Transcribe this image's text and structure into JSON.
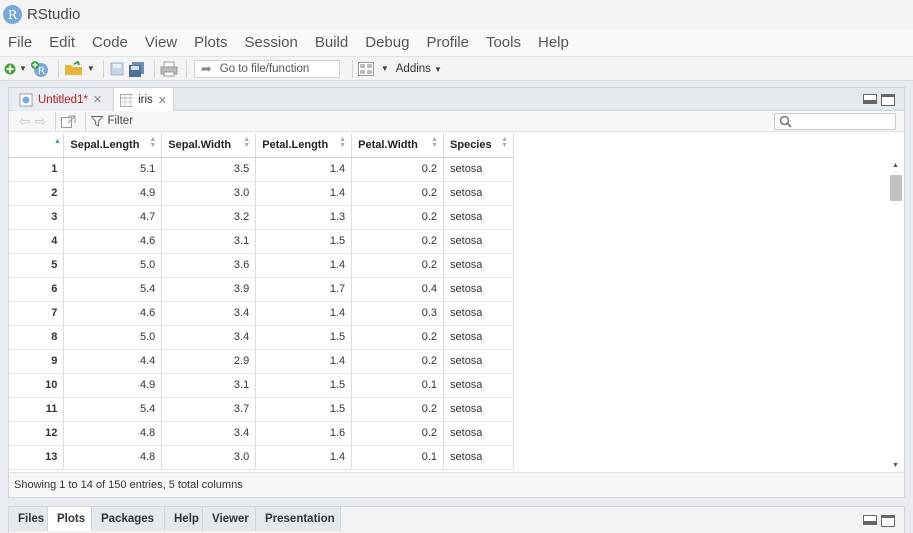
{
  "app": {
    "logo_letter": "R",
    "title": "RStudio"
  },
  "menu": [
    "File",
    "Edit",
    "Code",
    "View",
    "Plots",
    "Session",
    "Build",
    "Debug",
    "Profile",
    "Tools",
    "Help"
  ],
  "toolbar": {
    "goto_placeholder": "Go to file/function",
    "addins_label": "Addins"
  },
  "tabs": [
    {
      "label": "Untitled1*",
      "active": false
    },
    {
      "label": "iris",
      "active": true
    }
  ],
  "viewer": {
    "filter_label": "Filter",
    "search_value": ""
  },
  "table": {
    "columns": [
      "",
      "Sepal.Length",
      "Sepal.Width",
      "Petal.Length",
      "Petal.Width",
      "Species"
    ],
    "rows": [
      [
        "1",
        "5.1",
        "3.5",
        "1.4",
        "0.2",
        "setosa"
      ],
      [
        "2",
        "4.9",
        "3.0",
        "1.4",
        "0.2",
        "setosa"
      ],
      [
        "3",
        "4.7",
        "3.2",
        "1.3",
        "0.2",
        "setosa"
      ],
      [
        "4",
        "4.6",
        "3.1",
        "1.5",
        "0.2",
        "setosa"
      ],
      [
        "5",
        "5.0",
        "3.6",
        "1.4",
        "0.2",
        "setosa"
      ],
      [
        "6",
        "5.4",
        "3.9",
        "1.7",
        "0.4",
        "setosa"
      ],
      [
        "7",
        "4.6",
        "3.4",
        "1.4",
        "0.3",
        "setosa"
      ],
      [
        "8",
        "5.0",
        "3.4",
        "1.5",
        "0.2",
        "setosa"
      ],
      [
        "9",
        "4.4",
        "2.9",
        "1.4",
        "0.2",
        "setosa"
      ],
      [
        "10",
        "4.9",
        "3.1",
        "1.5",
        "0.1",
        "setosa"
      ],
      [
        "11",
        "5.4",
        "3.7",
        "1.5",
        "0.2",
        "setosa"
      ],
      [
        "12",
        "4.8",
        "3.4",
        "1.6",
        "0.2",
        "setosa"
      ],
      [
        "13",
        "4.8",
        "3.0",
        "1.4",
        "0.1",
        "setosa"
      ]
    ]
  },
  "status": "Showing 1 to 14 of 150 entries, 5 total columns",
  "bottom_tabs": [
    {
      "label": "Files",
      "active": false
    },
    {
      "label": "Plots",
      "active": true
    },
    {
      "label": "Packages",
      "active": false
    },
    {
      "label": "Help",
      "active": false
    },
    {
      "label": "Viewer",
      "active": false
    },
    {
      "label": "Presentation",
      "active": false
    }
  ]
}
